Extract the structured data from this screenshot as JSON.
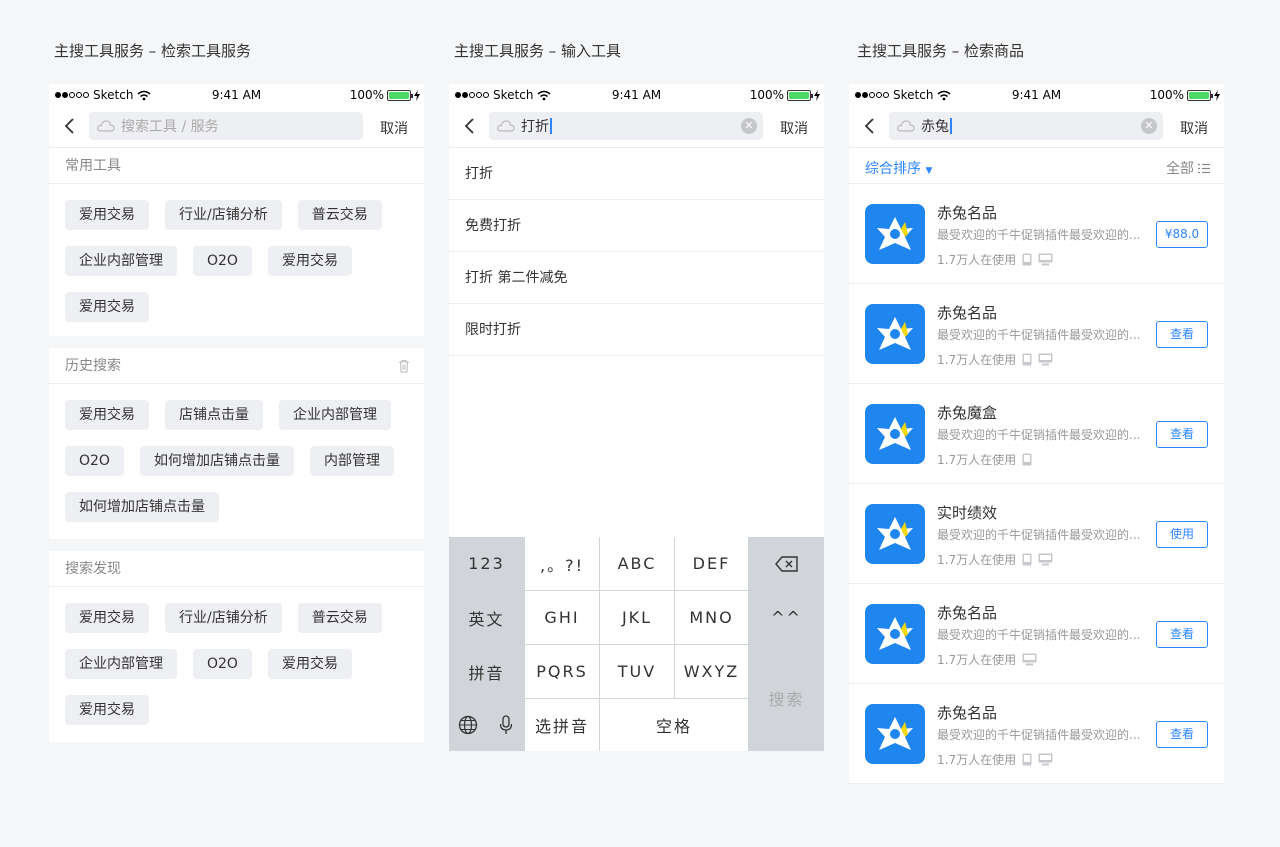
{
  "sections": [
    {
      "title": "主搜工具服务 – 检索工具服务"
    },
    {
      "title": "主搜工具服务 – 输入工具"
    },
    {
      "title": "主搜工具服务 – 检索商品"
    }
  ],
  "status_bar": {
    "carrier": "Sketch",
    "time": "9:41 AM",
    "battery": "100%"
  },
  "screen1": {
    "search_placeholder": "搜索工具 / 服务",
    "cancel": "取消",
    "common_tools": {
      "heading": "常用工具",
      "tags": [
        "爱用交易",
        "行业/店铺分析",
        "普云交易",
        "企业内部管理",
        "O2O",
        "爱用交易",
        "爱用交易"
      ]
    },
    "history": {
      "heading": "历史搜索",
      "tags": [
        "爱用交易",
        "店铺点击量",
        "企业内部管理",
        "O2O",
        "如何增加店铺点击量",
        "内部管理",
        "如何增加店铺点击量"
      ]
    },
    "discover": {
      "heading": "搜索发现",
      "tags": [
        "爱用交易",
        "行业/店铺分析",
        "普云交易",
        "企业内部管理",
        "O2O",
        "爱用交易",
        "爱用交易"
      ]
    }
  },
  "screen2": {
    "search_value": "打折",
    "cancel": "取消",
    "suggestions": [
      "打折",
      "免费打折",
      "打折 第二件减免",
      "限时打折"
    ],
    "keyboard": {
      "k123": "123",
      "punct": ",。?!",
      "abc": "ABC",
      "def": "DEF",
      "english": "英文",
      "ghi": "GHI",
      "jkl": "JKL",
      "mno": "MNO",
      "emoji": "^^",
      "pinyin": "拼音",
      "pqrs": "PQRS",
      "tuv": "TUV",
      "wxyz": "WXYZ",
      "search": "搜索",
      "select_pinyin": "选拼音",
      "space": "空格"
    }
  },
  "screen3": {
    "search_value": "赤兔",
    "cancel": "取消",
    "sort_label": "综合排序",
    "filter_all": "全部",
    "products": [
      {
        "name": "赤兔名品",
        "desc": "最受欢迎的千牛促销插件最受欢迎的...",
        "users": "1.7万人在使用",
        "button": "¥88.0",
        "devices": [
          "phone",
          "desktop"
        ]
      },
      {
        "name": "赤兔名品",
        "desc": "最受欢迎的千牛促销插件最受欢迎的...",
        "users": "1.7万人在使用",
        "button": "查看",
        "devices": [
          "phone",
          "desktop"
        ]
      },
      {
        "name": "赤兔魔盒",
        "desc": "最受欢迎的千牛促销插件最受欢迎的...",
        "users": "1.7万人在使用",
        "button": "查看",
        "devices": [
          "phone"
        ]
      },
      {
        "name": "实时绩效",
        "desc": "最受欢迎的千牛促销插件最受欢迎的...",
        "users": "1.7万人在使用",
        "button": "使用",
        "devices": [
          "phone",
          "desktop"
        ]
      },
      {
        "name": "赤兔名品",
        "desc": "最受欢迎的千牛促销插件最受欢迎的...",
        "users": "1.7万人在使用",
        "button": "查看",
        "devices": [
          "desktop"
        ]
      },
      {
        "name": "赤兔名品",
        "desc": "最受欢迎的千牛促销插件最受欢迎的...",
        "users": "1.7万人在使用",
        "button": "查看",
        "devices": [
          "phone",
          "desktop"
        ]
      }
    ]
  },
  "colors": {
    "accent": "#2d86ff",
    "logo_bg": "#1f86f0",
    "logo_star": "#ffffff",
    "logo_accent": "#f5d90a",
    "tag_bg": "#eeeff2",
    "page_bg": "#f5f6f8"
  }
}
